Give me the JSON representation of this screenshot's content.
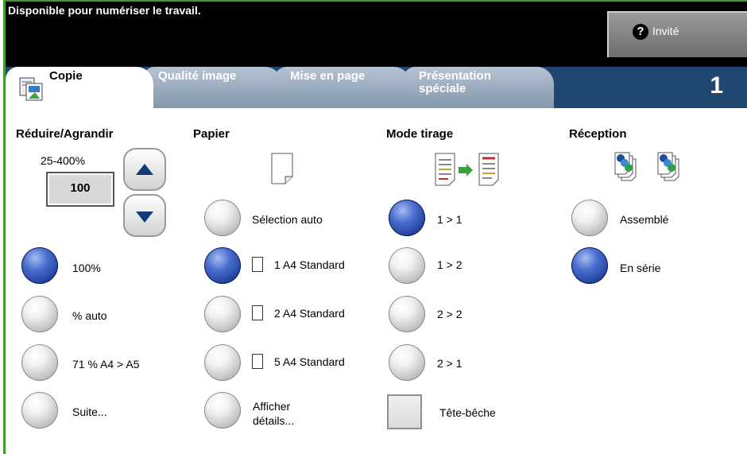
{
  "status": {
    "message": "Disponible pour numériser le travail."
  },
  "user": {
    "label": "Invité"
  },
  "tabs": [
    {
      "label": "Copie",
      "active": true
    },
    {
      "label": "Qualité image",
      "active": false
    },
    {
      "label": "Mise en page",
      "active": false
    },
    {
      "label": "Présentation spéciale",
      "active": false
    }
  ],
  "copy_count": "1",
  "reduce_enlarge": {
    "title": "Réduire/Agrandir",
    "range": "25-400%",
    "value": "100",
    "options": [
      {
        "label": "100%",
        "selected": true
      },
      {
        "label": "% auto",
        "selected": false
      },
      {
        "label": "71 % A4 > A5",
        "selected": false
      },
      {
        "label": "Suite...",
        "selected": false
      }
    ]
  },
  "paper": {
    "title": "Papier",
    "options": [
      {
        "label": "Sélection auto",
        "selected": false
      },
      {
        "label": "1 A4 Standard",
        "selected": true
      },
      {
        "label": "2 A4 Standard",
        "selected": false
      },
      {
        "label": "5 A4 Standard",
        "selected": false
      }
    ],
    "more_line1": "Afficher",
    "more_line2": "détails..."
  },
  "print_mode": {
    "title": "Mode tirage",
    "options": [
      {
        "label": "1 > 1",
        "selected": true
      },
      {
        "label": "1 > 2",
        "selected": false
      },
      {
        "label": "2 > 2",
        "selected": false
      },
      {
        "label": "2 > 1",
        "selected": false
      }
    ],
    "head_to_toe": {
      "label": "Tête-bêche",
      "checked": false
    }
  },
  "output": {
    "title": "Réception",
    "options": [
      {
        "label": "Assemblé",
        "selected": false
      },
      {
        "label": "En série",
        "selected": true
      }
    ]
  },
  "colors": {
    "status_bg": "#000000",
    "tab_strip": "#1f4770",
    "accent_green": "#3f9d2e",
    "radio_on": "#1c3a96"
  }
}
